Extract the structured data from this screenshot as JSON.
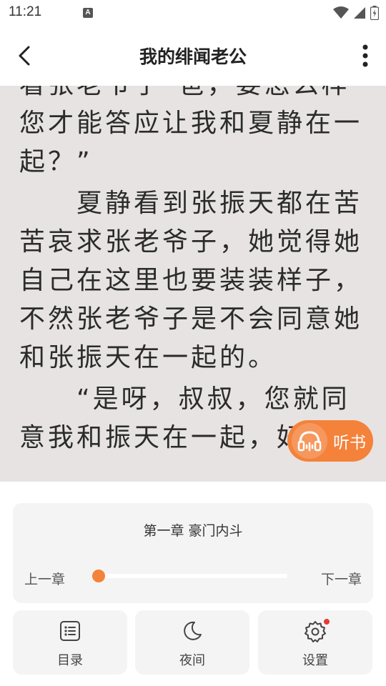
{
  "status_bar": {
    "time": "11:21",
    "notification_icon": "A"
  },
  "header": {
    "title": "我的绯闻老公"
  },
  "reader": {
    "paragraphs": [
      "看张老爷子“爸，要怎么样您才能答应让我和夏静在一起？”",
      "夏静看到张振天都在苦苦哀求张老爷子，她觉得她自己在这里也要装装样子，不然张老爷子是不会同意她和张振天在一起的。",
      "“是呀，叔叔，您就同意我和振天在一起，好吗？"
    ]
  },
  "listen_button": {
    "label": "听书"
  },
  "chapter_panel": {
    "chapter_title": "第一章 豪门内斗",
    "prev_label": "上一章",
    "next_label": "下一章",
    "progress": 0.0
  },
  "toolbar": {
    "catalog_label": "目录",
    "night_label": "夜间",
    "settings_label": "设置"
  },
  "colors": {
    "accent": "#f4823a",
    "reader_bg": "#e6e3e2",
    "badge": "#e53935"
  }
}
